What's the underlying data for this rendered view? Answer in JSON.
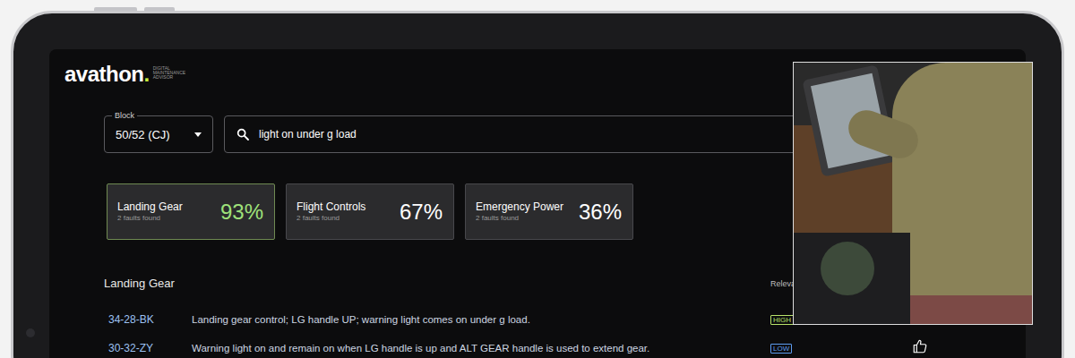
{
  "brand": {
    "name": "avathon",
    "dot": ".",
    "tagline": [
      "DIGITAL",
      "MAINTENANCE",
      "ADVISOR"
    ]
  },
  "block_select": {
    "label": "Block",
    "value": "50/52 (CJ)"
  },
  "search": {
    "value": "light on under g load"
  },
  "categories": [
    {
      "name": "Landing Gear",
      "count": "2 faults found",
      "score": "93%",
      "selected": true
    },
    {
      "name": "Flight Controls",
      "count": "2 faults found",
      "score": "67%",
      "selected": false
    },
    {
      "name": "Emergency Power",
      "count": "2 faults found",
      "score": "36%",
      "selected": false
    }
  ],
  "section": {
    "title": "Landing Gear",
    "relevance_header": "Relevan"
  },
  "faults": [
    {
      "code": "34-28-BK",
      "description": "Landing gear control; LG handle UP; warning light comes on under g load.",
      "relevance": "HIGH",
      "color": "#b8e46a"
    },
    {
      "code": "30-32-ZY",
      "description": "Warning light on and remain on when LG handle is up and ALT GEAR handle is used to extend gear.",
      "relevance": "LOW",
      "color": "#5d9cf0"
    }
  ]
}
